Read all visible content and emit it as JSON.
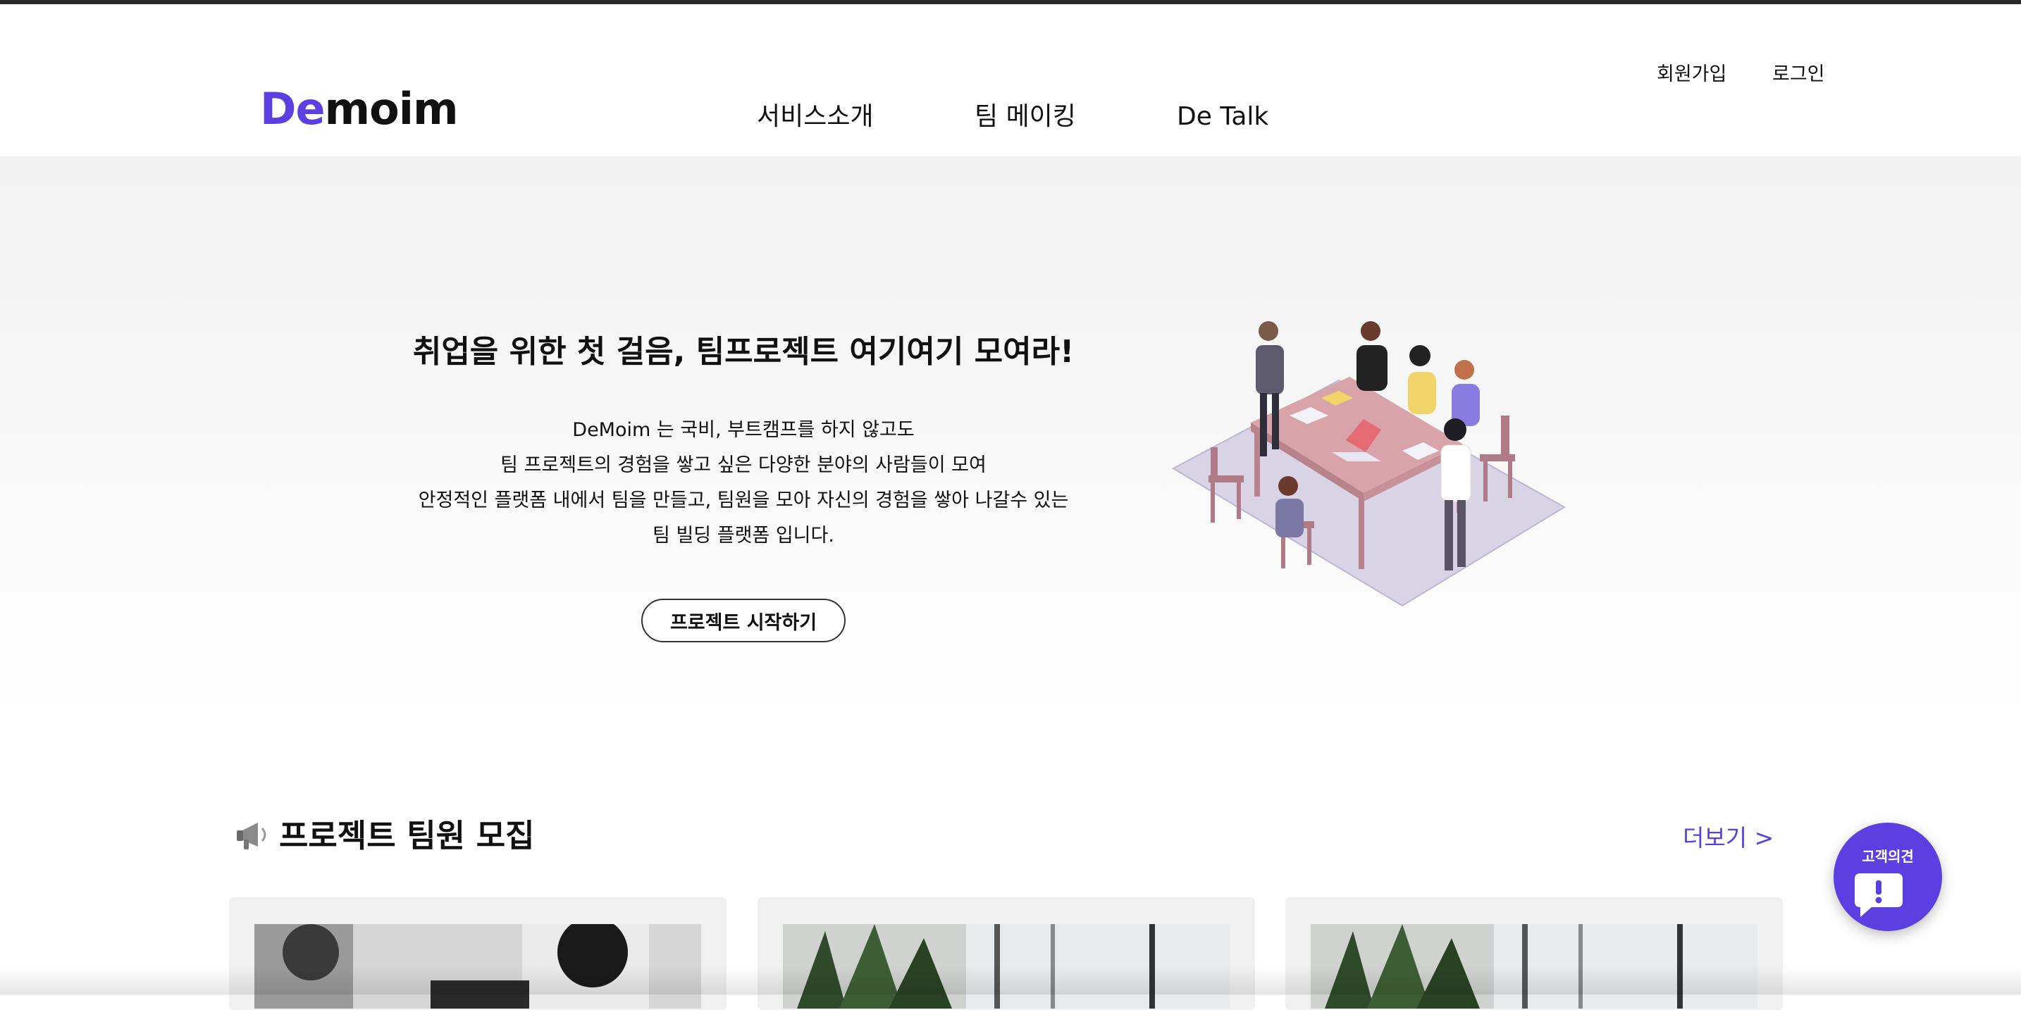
{
  "header": {
    "logo": {
      "part1": "De",
      "part2": "moim"
    },
    "nav": [
      {
        "label": "서비스소개"
      },
      {
        "label": "팀 메이킹"
      },
      {
        "label": "De Talk"
      }
    ],
    "auth": {
      "signup": "회원가입",
      "login": "로그인"
    }
  },
  "hero": {
    "title": "취업을 위한 첫 걸음, 팀프로젝트 여기여기 모여라!",
    "lines": [
      "DeMoim 는 국비, 부트캠프를 하지 않고도",
      "팀 프로젝트의 경험을 쌓고 싶은 다양한 분야의 사람들이 모여",
      "안정적인 플랫폼 내에서 팀을 만들고, 팀원을 모아 자신의 경험을 쌓아 나갈수 있는",
      "팀 빌딩 플랫폼 입니다."
    ],
    "cta": "프로젝트 시작하기"
  },
  "recruit": {
    "icon": "megaphone-icon",
    "title": "프로젝트 팀원 모집",
    "more": "더보기 >"
  },
  "feedback": {
    "label": "고객의견",
    "icon": "speech-bubble-exclamation-icon"
  },
  "colors": {
    "brand": "#5b3fe0",
    "text": "#111111",
    "hero_bg": "#f3f3f3"
  }
}
